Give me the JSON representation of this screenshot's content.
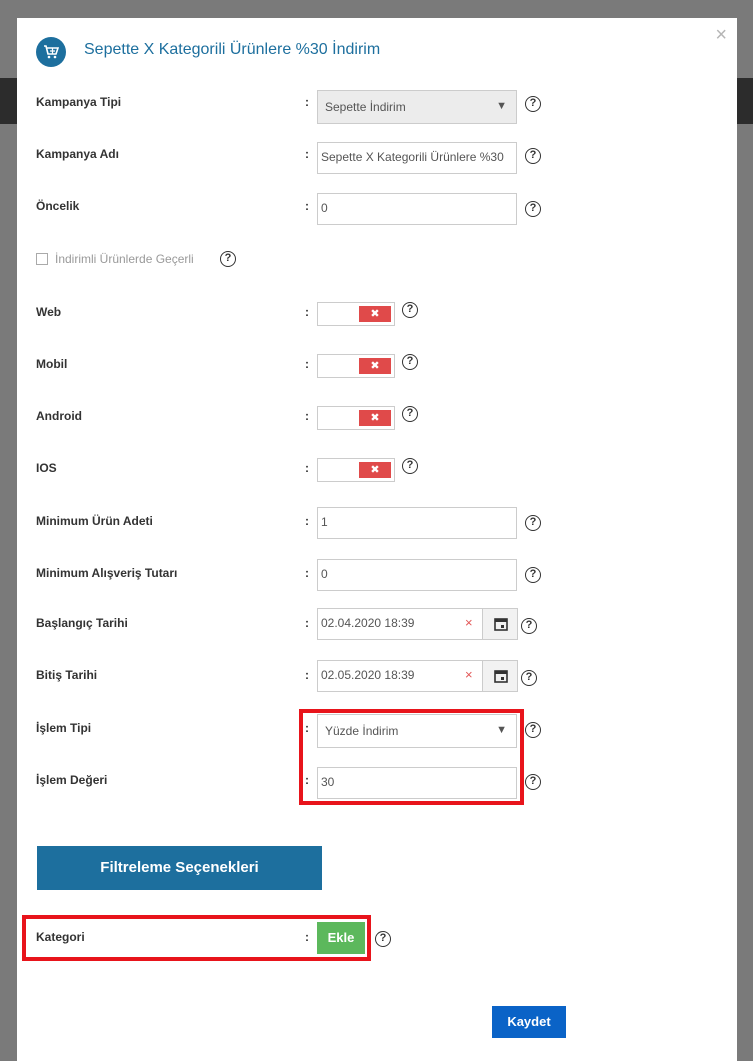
{
  "modal": {
    "title": "Sepette X Kategorili Ürünlere %30 İndirim",
    "close": "×"
  },
  "fields": {
    "campaign_type": {
      "label": "Kampanya Tipi",
      "value": "Sepette İndirim"
    },
    "campaign_name": {
      "label": "Kampanya Adı",
      "value": "Sepette X Kategorili Ürünlere %30"
    },
    "priority": {
      "label": "Öncelik",
      "value": "0"
    },
    "discounted_products": {
      "label": "İndirimli Ürünlerde Geçerli",
      "checked": false
    },
    "web": {
      "label": "Web",
      "knob": "✖"
    },
    "mobile": {
      "label": "Mobil",
      "knob": "✖"
    },
    "android": {
      "label": "Android",
      "knob": "✖"
    },
    "ios": {
      "label": "IOS",
      "knob": "✖"
    },
    "min_product_count": {
      "label": "Minimum Ürün Adeti",
      "value": "1"
    },
    "min_purchase_amount": {
      "label": "Minimum Alışveriş Tutarı",
      "value": "0"
    },
    "start_date": {
      "label": "Başlangıç Tarihi",
      "value": "02.04.2020 18:39"
    },
    "end_date": {
      "label": "Bitiş Tarihi",
      "value": "02.05.2020 18:39"
    },
    "operation_type": {
      "label": "İşlem Tipi",
      "value": "Yüzde İndirim"
    },
    "operation_value": {
      "label": "İşlem Değeri",
      "value": "30"
    },
    "category": {
      "label": "Kategori",
      "button": "Ekle"
    }
  },
  "colon": ":",
  "help": "?",
  "caret": "▼",
  "date_clear": "×",
  "filter_button": "Filtreleme Seçenekleri",
  "save_button": "Kaydet",
  "colors": {
    "primary": "#1d6f9e",
    "danger": "#e04a4a",
    "success": "#5cb85c",
    "highlight": "#e8141b",
    "save": "#0a63c7"
  }
}
